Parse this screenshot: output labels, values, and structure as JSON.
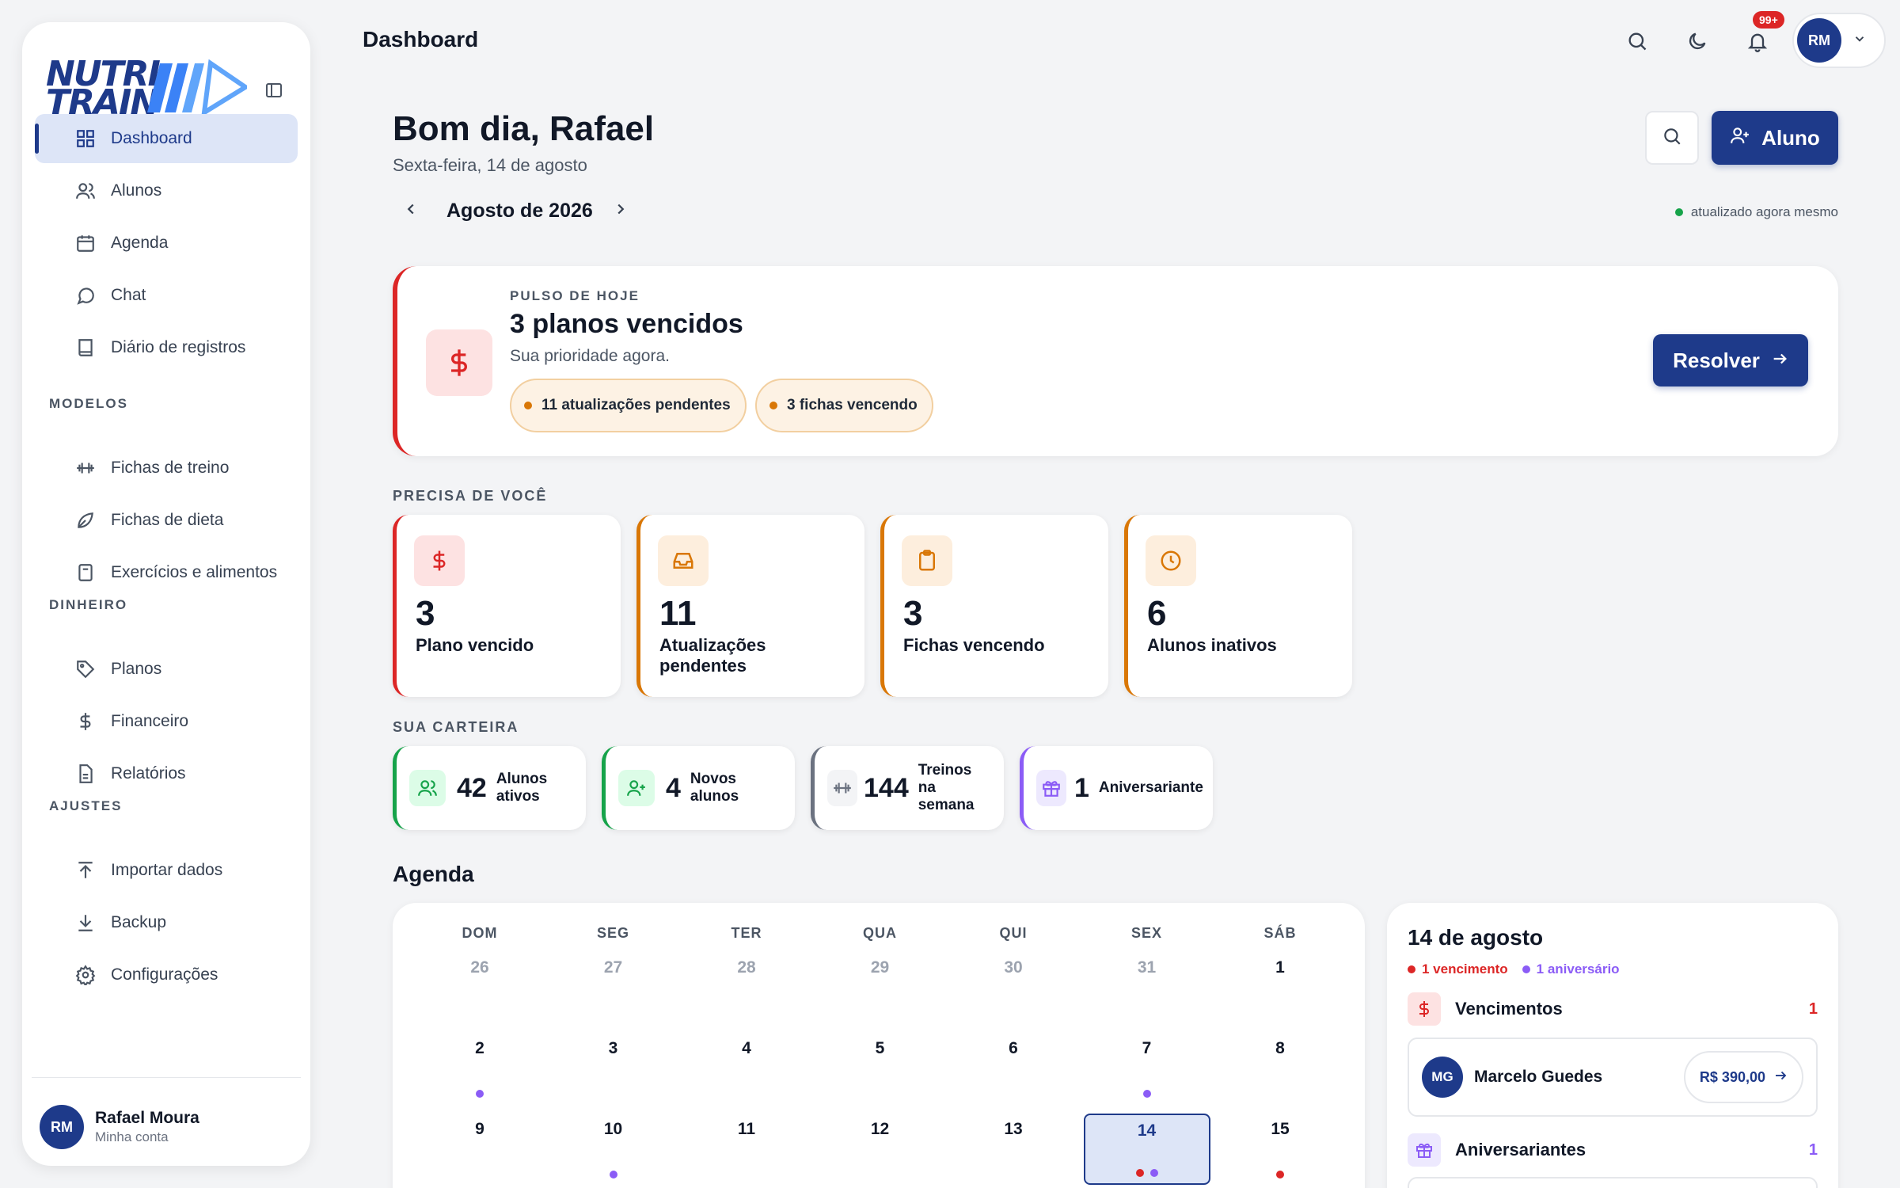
{
  "app": {
    "brand": "NUTRI TRAIN",
    "page_title": "Dashboard"
  },
  "colors": {
    "primary": "#1e3a8a",
    "danger": "#dc2626",
    "warning": "#d97706",
    "success": "#16a34a",
    "purple": "#8b5cf6",
    "gray": "#6b7280"
  },
  "sidebar": {
    "items": [
      {
        "label": "Dashboard",
        "icon": "grid-icon",
        "active": true
      },
      {
        "label": "Alunos",
        "icon": "users-icon"
      },
      {
        "label": "Agenda",
        "icon": "calendar-icon"
      },
      {
        "label": "Chat",
        "icon": "chat-icon"
      },
      {
        "label": "Diário de registros",
        "icon": "book-icon"
      }
    ],
    "sections": [
      {
        "title": "MODELOS",
        "items": [
          {
            "label": "Fichas de treino",
            "icon": "dumbbell-icon"
          },
          {
            "label": "Fichas de dieta",
            "icon": "leaf-icon"
          },
          {
            "label": "Exercícios e alimentos",
            "icon": "clipboard-icon"
          }
        ]
      },
      {
        "title": "DINHEIRO",
        "items": [
          {
            "label": "Planos",
            "icon": "tag-icon"
          },
          {
            "label": "Financeiro",
            "icon": "dollar-icon"
          },
          {
            "label": "Relatórios",
            "icon": "report-icon"
          }
        ]
      },
      {
        "title": "AJUSTES",
        "items": [
          {
            "label": "Importar dados",
            "icon": "upload-icon"
          },
          {
            "label": "Backup",
            "icon": "download-icon"
          },
          {
            "label": "Configurações",
            "icon": "gear-icon"
          }
        ]
      }
    ],
    "user": {
      "initials": "RM",
      "name": "Rafael Moura",
      "subtitle": "Minha conta"
    }
  },
  "topbar": {
    "notification_badge": "99+",
    "account_initials": "RM"
  },
  "header": {
    "greeting": "Bom dia, Rafael",
    "date": "Sexta-feira, 14 de agosto",
    "month": "Agosto de 2026",
    "add_button": "Aluno",
    "updated": "atualizado agora mesmo"
  },
  "pulse": {
    "kicker": "PULSO DE HOJE",
    "title": "3 planos vencidos",
    "subtitle": "Sua prioridade agora.",
    "pills": [
      "11 atualizações pendentes",
      "3 fichas vencendo"
    ],
    "action": "Resolver"
  },
  "needs": {
    "title": "PRECISA DE VOCÊ",
    "cards": [
      {
        "value": "3",
        "label": "Plano vencido",
        "icon": "dollar-icon",
        "color": "#dc2626",
        "bg": "#fde2e2"
      },
      {
        "value": "11",
        "label": "Atualizações pendentes",
        "icon": "inbox-icon",
        "color": "#d97706",
        "bg": "#fdeedd"
      },
      {
        "value": "3",
        "label": "Fichas vencendo",
        "icon": "clipboard-icon",
        "color": "#d97706",
        "bg": "#fdeedd"
      },
      {
        "value": "6",
        "label": "Alunos inativos",
        "icon": "clock-icon",
        "color": "#d97706",
        "bg": "#fdeedd"
      }
    ]
  },
  "wallet": {
    "title": "SUA CARTEIRA",
    "cards": [
      {
        "value": "42",
        "label_1": "Alunos",
        "label_2": "ativos",
        "label_3": "",
        "icon": "users-icon",
        "color": "#16a34a",
        "bg": "#dcfce7"
      },
      {
        "value": "4",
        "label_1": "Novos",
        "label_2": "alunos",
        "label_3": "",
        "icon": "user-plus-icon",
        "color": "#16a34a",
        "bg": "#dcfce7"
      },
      {
        "value": "144",
        "label_1": "Treinos",
        "label_2": "na",
        "label_3": "semana",
        "icon": "dumbbell-icon",
        "color": "#6b7280",
        "bg": "#f3f4f6"
      },
      {
        "value": "1",
        "label_1": "Aniversariante",
        "label_2": "",
        "label_3": "",
        "icon": "gift-icon",
        "color": "#8b5cf6",
        "bg": "#ede9fe"
      }
    ]
  },
  "agenda": {
    "title": "Agenda",
    "weekdays": [
      "DOM",
      "SEG",
      "TER",
      "QUA",
      "QUI",
      "SEX",
      "SÁB"
    ],
    "weeks": [
      [
        {
          "d": "26",
          "m": true
        },
        {
          "d": "27",
          "m": true
        },
        {
          "d": "28",
          "m": true
        },
        {
          "d": "29",
          "m": true
        },
        {
          "d": "30",
          "m": true
        },
        {
          "d": "31",
          "m": true
        },
        {
          "d": "1"
        }
      ],
      [
        {
          "d": "2",
          "dots": [
            "purple"
          ]
        },
        {
          "d": "3"
        },
        {
          "d": "4"
        },
        {
          "d": "5"
        },
        {
          "d": "6"
        },
        {
          "d": "7",
          "dots": [
            "purple"
          ]
        },
        {
          "d": "8"
        }
      ],
      [
        {
          "d": "9"
        },
        {
          "d": "10",
          "dots": [
            "purple"
          ]
        },
        {
          "d": "11"
        },
        {
          "d": "12"
        },
        {
          "d": "13"
        },
        {
          "d": "14",
          "today": true,
          "dots": [
            "red",
            "purple"
          ]
        },
        {
          "d": "15",
          "dots": [
            "red"
          ]
        }
      ]
    ]
  },
  "day_panel": {
    "title": "14 de agosto",
    "summary": [
      "1 vencimento",
      "1 aniversário"
    ],
    "dues_label": "Vencimentos",
    "dues_count": "1",
    "due_item": {
      "initials": "MG",
      "name": "Marcelo Guedes",
      "amount": "R$ 390,00"
    },
    "birthdays_label": "Aniversariantes",
    "birthdays_count": "1"
  }
}
